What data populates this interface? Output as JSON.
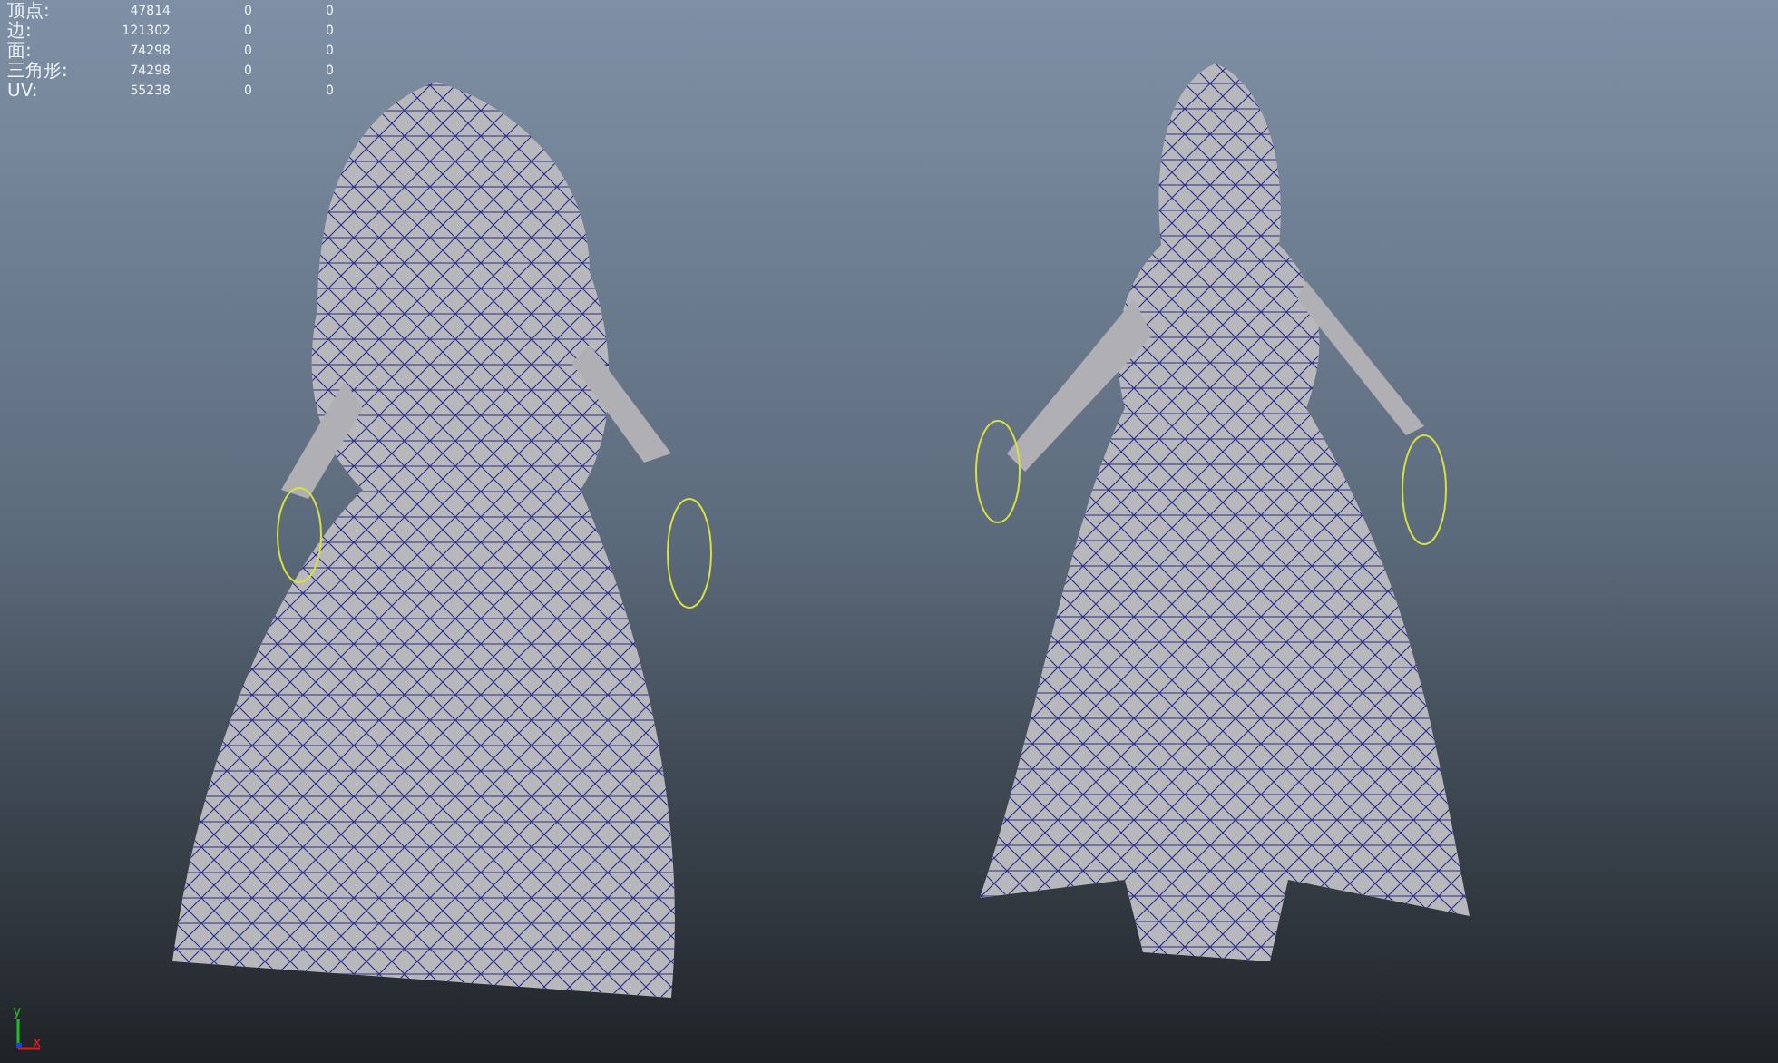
{
  "hud": {
    "rows": [
      {
        "label": "顶点:",
        "values": [
          "47814",
          "0",
          "0"
        ]
      },
      {
        "label": "边:",
        "values": [
          "121302",
          "0",
          "0"
        ]
      },
      {
        "label": "面:",
        "values": [
          "74298",
          "0",
          "0"
        ]
      },
      {
        "label": "三角形:",
        "values": [
          "74298",
          "0",
          "0"
        ]
      },
      {
        "label": "UV:",
        "values": [
          "55238",
          "0",
          "0"
        ]
      }
    ]
  },
  "axis": {
    "y": "y",
    "x": "x"
  }
}
